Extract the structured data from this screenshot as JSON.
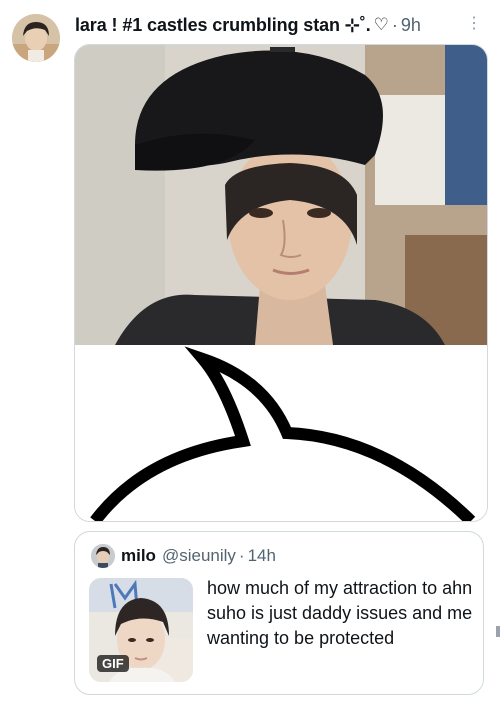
{
  "tweet": {
    "display_name": "lara ! #1 castles crumbling stan ⊹˚.",
    "heart_glyph": "♡",
    "separator": "·",
    "time": "9h",
    "more_icon": "⋮"
  },
  "quote": {
    "display_name": "milo",
    "handle": "@sieunily",
    "separator": "·",
    "time": "14h",
    "text": "how much of my attraction to ahn suho is just daddy issues and me wanting to be protected",
    "gif_badge": "GIF"
  },
  "colors": {
    "secondary_text": "#536471",
    "border": "#cfd9de"
  }
}
